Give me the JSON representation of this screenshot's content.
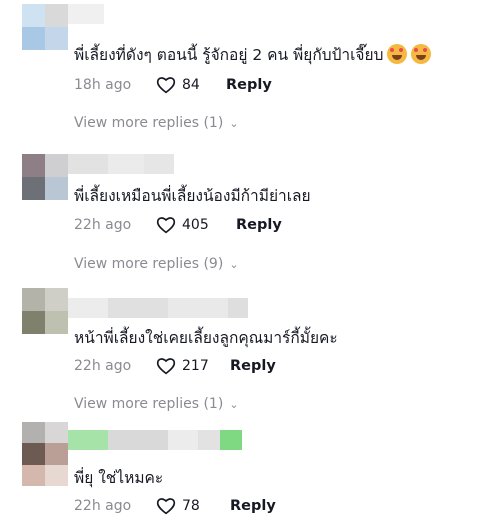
{
  "comments": [
    {
      "text": "พี่เลี้ยงที่ดังๆ ตอนนี้ รู้จักอยู่ 2 คน พี่ยุกับป้าเจี๊ยบ",
      "time": "18h ago",
      "likes": "84",
      "reply_label": "Reply",
      "view_more": "View more replies (1)",
      "emojis": [
        "smiling-face-with-hearts",
        "smiling-face-with-hearts"
      ]
    },
    {
      "text": "พี่เลี้ยงเหมือนพี่เลี้ยงน้องมีก้ามีย่าเลย",
      "time": "22h ago",
      "likes": "405",
      "reply_label": "Reply",
      "view_more": "View more replies (9)"
    },
    {
      "text": "หน้าพี่เลี้ยงใช่เคยเลี้ยงลูกคุณมาร์กี้มั้ยคะ",
      "time": "22h ago",
      "likes": "217",
      "reply_label": "Reply",
      "view_more": "View more replies (1)"
    },
    {
      "text": "พี่ยุ ใช่ไหมคะ",
      "time": "22h ago",
      "likes": "78",
      "reply_label": "Reply"
    }
  ],
  "icons": {
    "like": "heart-outline-icon",
    "expand": "chevron-down-icon"
  },
  "colors": {
    "text": "#161823",
    "muted": "#8a8b91"
  }
}
